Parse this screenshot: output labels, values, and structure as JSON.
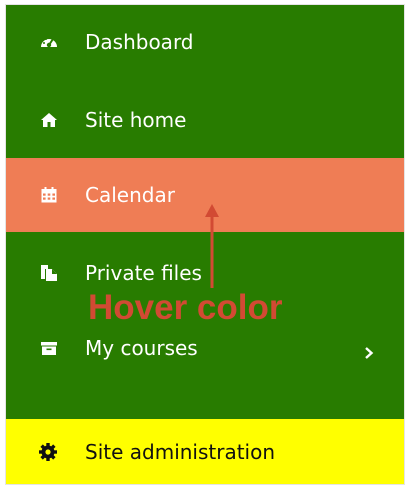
{
  "colors": {
    "menu_background": "#287c00",
    "hover_background": "#ef7d55",
    "admin_background": "#ffff00",
    "annotation_color": "#d24a33"
  },
  "menu": {
    "items": [
      {
        "label": "Dashboard",
        "icon": "dashboard-gauge-icon"
      },
      {
        "label": "Site home",
        "icon": "home-icon"
      },
      {
        "label": "Calendar",
        "icon": "calendar-icon",
        "state": "hover"
      },
      {
        "label": "Private files",
        "icon": "files-icon"
      },
      {
        "label": "My courses",
        "icon": "archive-box-icon",
        "has_submenu": true,
        "submenu_icon": "chevron-right-icon"
      }
    ],
    "admin": {
      "label": "Site administration",
      "icon": "gear-icon"
    }
  },
  "annotation": {
    "text": "Hover color",
    "pointer": "arrow-up-icon"
  }
}
